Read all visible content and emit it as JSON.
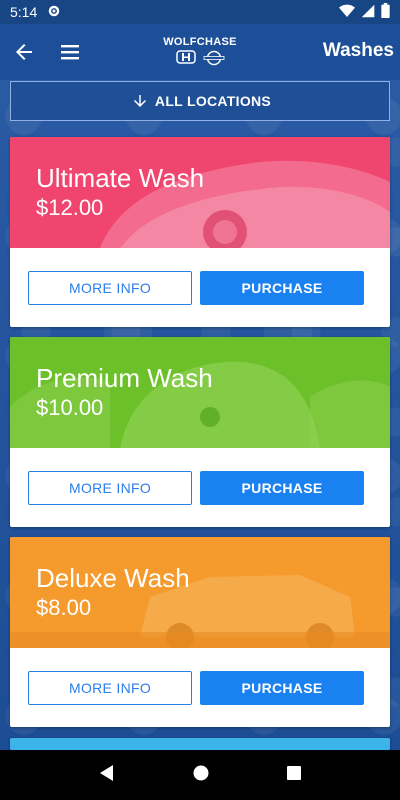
{
  "status_bar": {
    "time": "5:14",
    "icons": [
      "settings-icon",
      "wifi-icon",
      "signal-icon",
      "battery-icon"
    ]
  },
  "app_bar": {
    "logo_text": "WOLFCHASE",
    "logo_marks": [
      "HONDA",
      "NISSAN"
    ],
    "title": "Washes"
  },
  "locations_button": {
    "label": "ALL LOCATIONS"
  },
  "washes": [
    {
      "name": "Ultimate Wash",
      "price": "$12.00",
      "info_label": "MORE INFO",
      "buy_label": "PURCHASE",
      "color": "#f0456e"
    },
    {
      "name": "Premium Wash",
      "price": "$10.00",
      "info_label": "MORE INFO",
      "buy_label": "PURCHASE",
      "color": "#6cc12a"
    },
    {
      "name": "Deluxe Wash",
      "price": "$8.00",
      "info_label": "MORE INFO",
      "buy_label": "PURCHASE",
      "color": "#f59a2d"
    },
    {
      "color": "#3cb3e9"
    }
  ],
  "colors": {
    "primary": "#1d4f98",
    "accent": "#1a82f0"
  }
}
